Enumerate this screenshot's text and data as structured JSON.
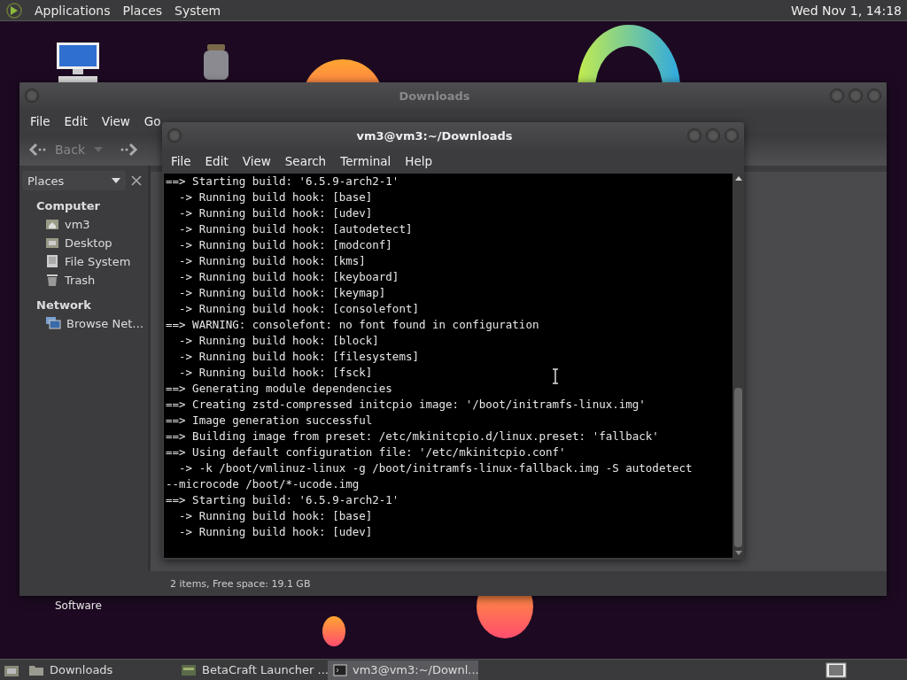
{
  "top_panel": {
    "menus": [
      "Applications",
      "Places",
      "System"
    ],
    "clock": "Wed Nov 1, 14:18"
  },
  "desktop": {
    "icon_labels": [
      "Software"
    ]
  },
  "file_manager": {
    "title": "Downloads",
    "menu": [
      "File",
      "Edit",
      "View",
      "Go"
    ],
    "back": "Back",
    "sidebar": {
      "selector": "Places",
      "sections": [
        {
          "heading": "Computer",
          "items": [
            {
              "label": "vm3",
              "kind": "home"
            },
            {
              "label": "Desktop",
              "kind": "desktop"
            },
            {
              "label": "File System",
              "kind": "drive"
            },
            {
              "label": "Trash",
              "kind": "trash"
            }
          ]
        },
        {
          "heading": "Network",
          "items": [
            {
              "label": "Browse Net…",
              "kind": "network"
            }
          ]
        }
      ]
    },
    "status": "2 items, Free space: 19.1 GB"
  },
  "terminal": {
    "title": "vm3@vm3:~/Downloads",
    "menu": [
      "File",
      "Edit",
      "View",
      "Search",
      "Terminal",
      "Help"
    ],
    "lines": [
      "==> Starting build: '6.5.9-arch2-1'",
      "  -> Running build hook: [base]",
      "  -> Running build hook: [udev]",
      "  -> Running build hook: [autodetect]",
      "  -> Running build hook: [modconf]",
      "  -> Running build hook: [kms]",
      "  -> Running build hook: [keyboard]",
      "  -> Running build hook: [keymap]",
      "  -> Running build hook: [consolefont]",
      "==> WARNING: consolefont: no font found in configuration",
      "  -> Running build hook: [block]",
      "  -> Running build hook: [filesystems]",
      "  -> Running build hook: [fsck]",
      "==> Generating module dependencies",
      "==> Creating zstd-compressed initcpio image: '/boot/initramfs-linux.img'",
      "==> Image generation successful",
      "==> Building image from preset: /etc/mkinitcpio.d/linux.preset: 'fallback'",
      "==> Using default configuration file: '/etc/mkinitcpio.conf'",
      "  -> -k /boot/vmlinuz-linux -g /boot/initramfs-linux-fallback.img -S autodetect",
      "--microcode /boot/*-ucode.img",
      "==> Starting build: '6.5.9-arch2-1'",
      "  -> Running build hook: [base]",
      "  -> Running build hook: [udev]"
    ]
  },
  "taskbar": {
    "tasks": [
      {
        "label": "Downloads",
        "kind": "folder",
        "selected": false
      },
      {
        "label": "BetaCraft Launcher ...",
        "kind": "app",
        "selected": false
      },
      {
        "label": "vm3@vm3:~/Downl...",
        "kind": "terminal",
        "selected": true
      }
    ]
  }
}
